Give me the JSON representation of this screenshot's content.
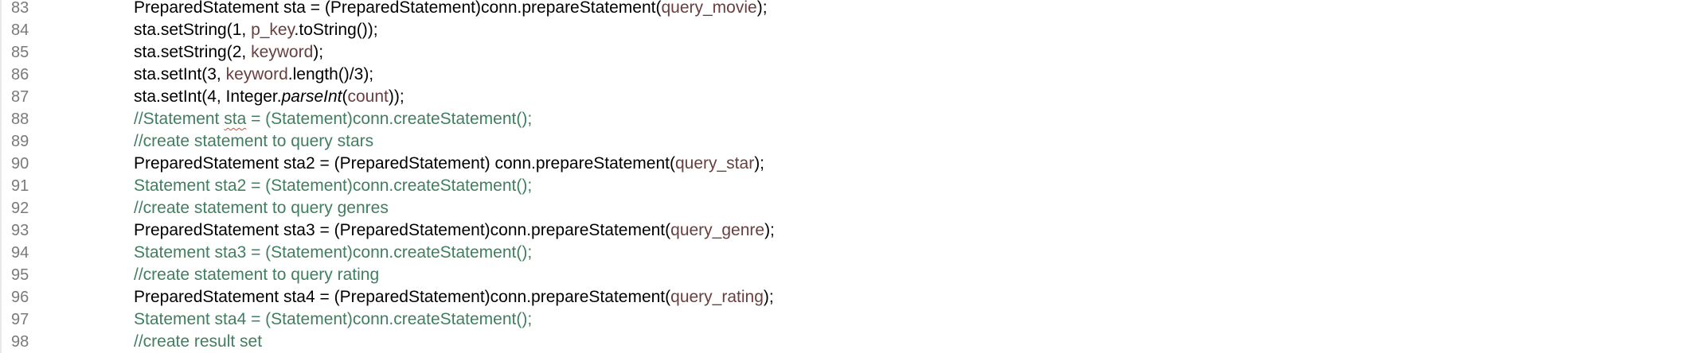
{
  "editor": {
    "colors": {
      "background": "#ffffff",
      "line_number": "#7a7a7a",
      "code_text": "#000000",
      "variable": "#6a3e3e",
      "comment": "#3f7f5f",
      "spell_error_underline": "#e04b2a"
    },
    "lines": [
      {
        "number": "83",
        "tokens": [
          {
            "text": "PreparedStatement sta = (PreparedStatement)conn.prepareStatement(",
            "kind": "text"
          },
          {
            "text": "query_movie",
            "kind": "var"
          },
          {
            "text": ");",
            "kind": "text"
          }
        ]
      },
      {
        "number": "84",
        "tokens": [
          {
            "text": "sta.setString(1, ",
            "kind": "text"
          },
          {
            "text": "p_key",
            "kind": "var"
          },
          {
            "text": ".toString());",
            "kind": "text"
          }
        ]
      },
      {
        "number": "85",
        "tokens": [
          {
            "text": "sta.setString(2, ",
            "kind": "text"
          },
          {
            "text": "keyword",
            "kind": "var"
          },
          {
            "text": ");",
            "kind": "text"
          }
        ]
      },
      {
        "number": "86",
        "tokens": [
          {
            "text": "sta.setInt(3, ",
            "kind": "text"
          },
          {
            "text": "keyword",
            "kind": "var"
          },
          {
            "text": ".length()/3);",
            "kind": "text"
          }
        ]
      },
      {
        "number": "87",
        "tokens": [
          {
            "text": "sta.setInt(4, Integer.",
            "kind": "text"
          },
          {
            "text": "parseInt",
            "kind": "static"
          },
          {
            "text": "(",
            "kind": "text"
          },
          {
            "text": "count",
            "kind": "var"
          },
          {
            "text": "));",
            "kind": "text"
          }
        ]
      },
      {
        "number": "88",
        "tokens": [
          {
            "text": "//Statement ",
            "kind": "comment"
          },
          {
            "text": "sta",
            "kind": "comment-err"
          },
          {
            "text": " = (Statement)conn.createStatement();",
            "kind": "comment"
          }
        ]
      },
      {
        "number": "89",
        "tokens": [
          {
            "text": "//create statement to query stars",
            "kind": "comment"
          }
        ]
      },
      {
        "number": "90",
        "tokens": [
          {
            "text": "PreparedStatement sta2 = (PreparedStatement) conn.prepareStatement(",
            "kind": "text"
          },
          {
            "text": "query_star",
            "kind": "var"
          },
          {
            "text": ");",
            "kind": "text"
          }
        ]
      },
      {
        "number": "91",
        "tokens": [
          {
            "text": "Statement sta2 = (Statement)conn.createStatement();",
            "kind": "comment"
          }
        ]
      },
      {
        "number": "92",
        "tokens": [
          {
            "text": "//create statement to query genres",
            "kind": "comment"
          }
        ]
      },
      {
        "number": "93",
        "tokens": [
          {
            "text": "PreparedStatement sta3 = (PreparedStatement)conn.prepareStatement(",
            "kind": "text"
          },
          {
            "text": "query_genre",
            "kind": "var"
          },
          {
            "text": ");",
            "kind": "text"
          }
        ]
      },
      {
        "number": "94",
        "tokens": [
          {
            "text": "Statement sta3 = (Statement)conn.createStatement();",
            "kind": "comment"
          }
        ]
      },
      {
        "number": "95",
        "tokens": [
          {
            "text": "//create statement to query rating",
            "kind": "comment"
          }
        ]
      },
      {
        "number": "96",
        "tokens": [
          {
            "text": "PreparedStatement sta4 = (PreparedStatement)conn.prepareStatement(",
            "kind": "text"
          },
          {
            "text": "query_rating",
            "kind": "var"
          },
          {
            "text": ");",
            "kind": "text"
          }
        ]
      },
      {
        "number": "97",
        "tokens": [
          {
            "text": "Statement sta4 = (Statement)conn.createStatement();",
            "kind": "comment"
          }
        ]
      },
      {
        "number": "98",
        "tokens": [
          {
            "text": "//create result set",
            "kind": "comment"
          }
        ]
      }
    ]
  }
}
